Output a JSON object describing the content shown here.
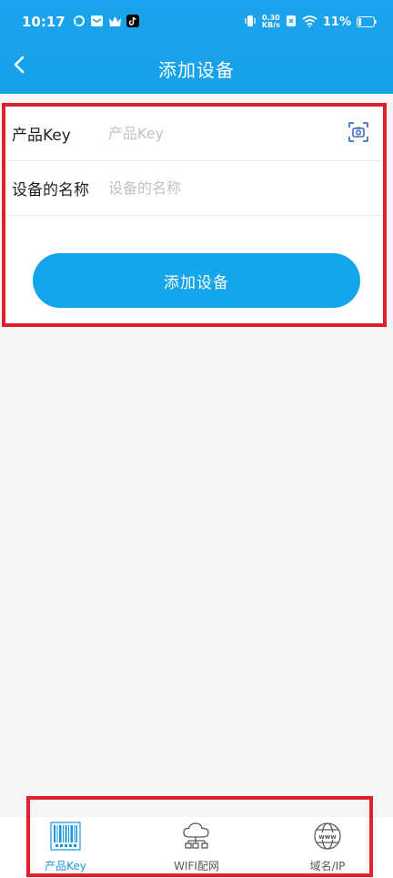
{
  "status_bar": {
    "time": "10:17",
    "net_speed_value": "0.30",
    "net_speed_unit": "KB/s",
    "battery": "11%"
  },
  "app_bar": {
    "title": "添加设备"
  },
  "form": {
    "product_key": {
      "label": "产品Key",
      "placeholder": "产品Key",
      "value": ""
    },
    "device_name": {
      "label": "设备的名称",
      "placeholder": "设备的名称",
      "value": ""
    },
    "submit_label": "添加设备"
  },
  "tabs": [
    {
      "label": "产品Key",
      "icon": "barcode-icon",
      "active": true
    },
    {
      "label": "WIFI配网",
      "icon": "cloud-network-icon",
      "active": false
    },
    {
      "label": "域名/IP",
      "icon": "globe-www-icon",
      "active": false
    }
  ],
  "colors": {
    "primary": "#14a5ea",
    "active_tab": "#1996de",
    "annotation": "#e0202a"
  }
}
